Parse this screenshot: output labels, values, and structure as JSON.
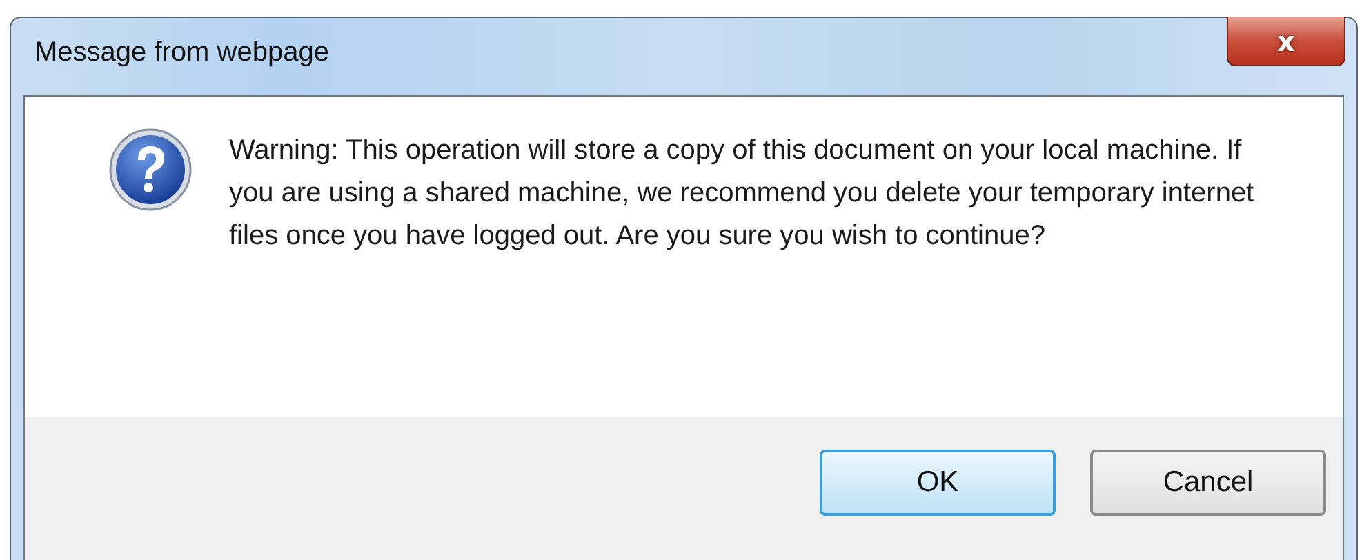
{
  "window": {
    "title": "Message from webpage",
    "close": "x"
  },
  "message": {
    "text": "Warning: This operation will store a copy of this document on your local machine. If you are using a shared machine, we recommend you delete your temporary internet files once you have logged out. Are you sure you wish to continue?"
  },
  "buttons": [
    {
      "label": "OK",
      "default": true
    },
    {
      "label": "Cancel",
      "default": false
    }
  ]
}
